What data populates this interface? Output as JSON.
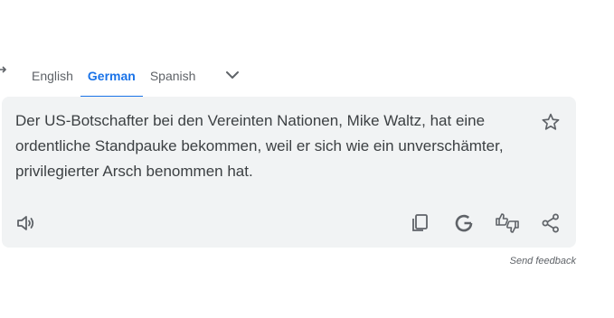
{
  "tabs": [
    {
      "label": "English",
      "active": false
    },
    {
      "label": "German",
      "active": true
    },
    {
      "label": "Spanish",
      "active": false
    }
  ],
  "translation": {
    "text": "Der US-Botschafter bei den Vereinten Nationen, Mike Waltz, hat eine ordentliche Standpauke bekommen, weil er sich wie ein unverschämter, privilegierter Arsch benommen hat."
  },
  "footer": {
    "send_feedback": "Send feedback"
  },
  "icons": {
    "swap": "swap-arrows-icon",
    "more_languages": "chevron-down-icon",
    "save": "star-icon",
    "listen": "speaker-icon",
    "copy": "copy-icon",
    "search": "google-g-icon",
    "rate": "thumbs-rating-icon",
    "share": "share-icon"
  },
  "colors": {
    "accent": "#1a73e8",
    "card_bg": "#f1f3f4",
    "icon": "#5f6368"
  }
}
